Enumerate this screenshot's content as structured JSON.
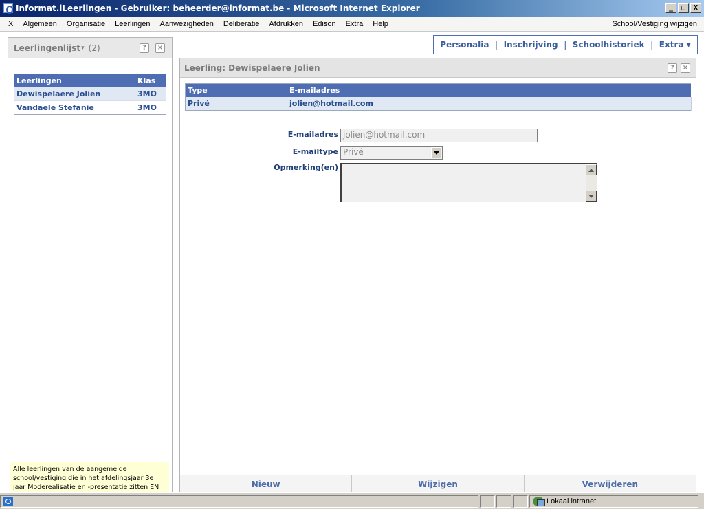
{
  "window": {
    "title": "Informat.iLeerlingen - Gebruiker: beheerder@informat.be - Microsoft Internet Explorer",
    "minimize": "_",
    "maximize": "□",
    "close": "X"
  },
  "menu": {
    "items": [
      "X",
      "Algemeen",
      "Organisatie",
      "Leerlingen",
      "Aanwezigheden",
      "Deliberatie",
      "Afdrukken",
      "Edison",
      "Extra",
      "Help"
    ],
    "school_link": "School/Vestiging wijzigen"
  },
  "left_panel": {
    "title": "Leerlingenlijst",
    "caret": "▾",
    "count": "(2)",
    "help_icon": "?",
    "close_icon": "×",
    "table": {
      "headers": [
        "Leerlingen",
        "Klas"
      ],
      "rows": [
        {
          "name": "Dewispelaere Jolien",
          "klas": "3MO"
        },
        {
          "name": "Vandaele Stefanie",
          "klas": "3MO"
        }
      ]
    },
    "note": "Alle leerlingen van de aangemelde school/vestiging die in het afdelingsjaar 3e jaar Moderealisatie en -presentatie zitten EN"
  },
  "top_nav": {
    "items": [
      "Personalia",
      "Inschrijving",
      "Schoolhistoriek",
      "Extra ▾"
    ],
    "separator": "|"
  },
  "right_panel": {
    "title": "Leerling: Dewispelaere Jolien",
    "help_icon": "?",
    "close_icon": "×",
    "table": {
      "headers": [
        "Type",
        "E-mailadres"
      ],
      "rows": [
        {
          "type": "Privé",
          "email": "jolien@hotmail.com"
        }
      ]
    },
    "form": {
      "email_label": "E-mailadres",
      "email_value": "jolien@hotmail.com",
      "emailtype_label": "E-mailtype",
      "emailtype_value": "Privé",
      "remark_label": "Opmerking(en)",
      "remark_value": ""
    },
    "actions": [
      "Nieuw",
      "Wijzigen",
      "Verwijderen"
    ]
  },
  "statusbar": {
    "zone": "Lokaal intranet"
  }
}
